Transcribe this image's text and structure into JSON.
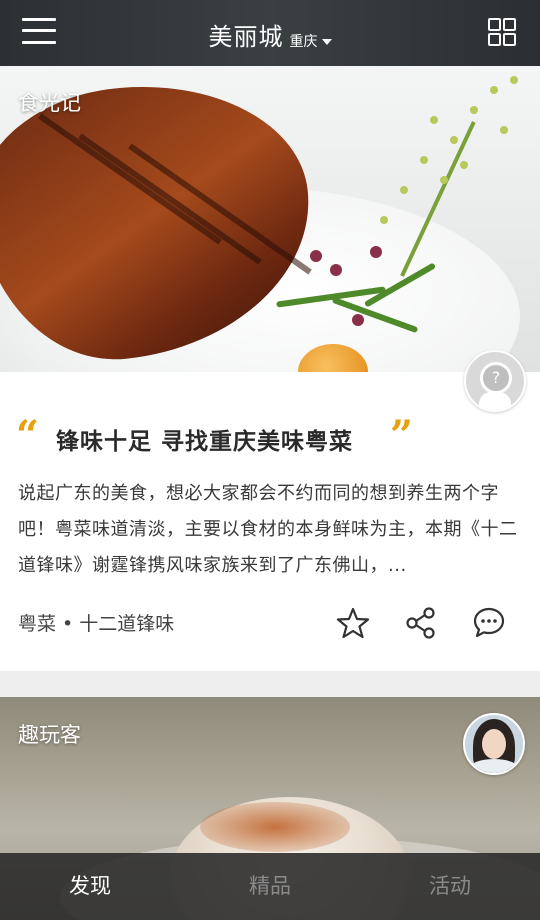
{
  "header": {
    "city": "美丽城",
    "district": "重庆",
    "menu_icon": "hamburger-menu-icon",
    "grid_icon": "grid-view-icon"
  },
  "feed": [
    {
      "source": "食光记",
      "title": "锋味十足 寻找重庆美味粤菜",
      "quote_open": "“",
      "quote_close": "”",
      "description": "说起广东的美食，想必大家都会不约而同的想到养生两个字吧！粤菜味道清淡，主要以食材的本身鲜味为主，本期《十二道锋味》谢霆锋携风味家族来到了广东佛山，...",
      "tags": "粤菜 • 十二道锋味",
      "actions": [
        "star-icon",
        "share-icon",
        "comment-icon"
      ]
    },
    {
      "source": "趣玩客"
    }
  ],
  "tabs": [
    {
      "label": "发现",
      "active": true
    },
    {
      "label": "精品",
      "active": false
    },
    {
      "label": "活动",
      "active": false
    }
  ],
  "colors": {
    "accent_quote": "#e5a20c",
    "topbar": "#33373b",
    "tab_active": "#ffffff",
    "tab_inactive": "#8a8a8a"
  }
}
